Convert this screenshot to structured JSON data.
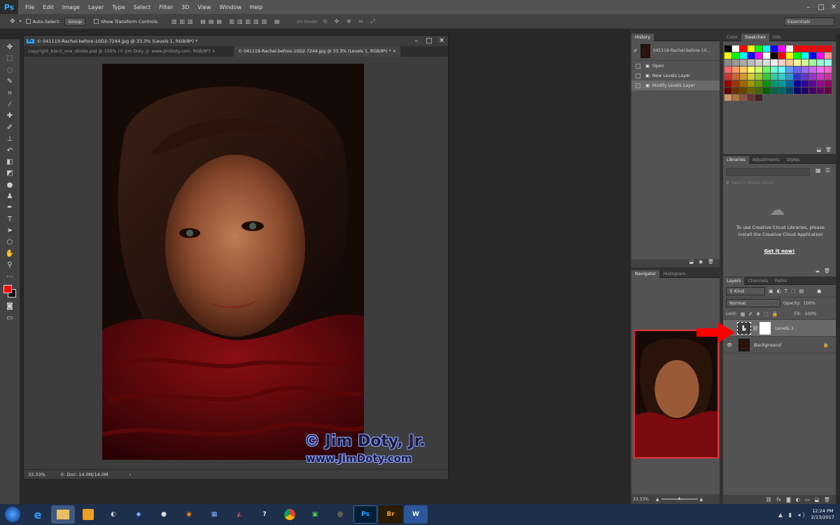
{
  "app": {
    "logo": "Ps"
  },
  "menu": [
    "File",
    "Edit",
    "Image",
    "Layer",
    "Type",
    "Select",
    "Filter",
    "3D",
    "View",
    "Window",
    "Help"
  ],
  "window_controls": [
    "–",
    "□",
    "✕"
  ],
  "options": {
    "auto_select_label": "Auto-Select:",
    "auto_select_value": "Group",
    "transform_label": "Show Transform Controls",
    "mode3d_label": "3D Mode:",
    "workspace": "Essentials"
  },
  "document": {
    "title": "© 041119-Rachel-before-10D2-7244.jpg @ 33.3% (Levels 1, RGB/8*) *",
    "tabs": [
      {
        "label": "copyright_black_one_stroke.psd @ 100% (© Jim Doty, Jr. www.JimDoty.com, RGB/8*) ×",
        "active": false
      },
      {
        "label": "© 041119-Rachel-before-10D2-7244.jpg @ 33.3% (Levels 1, RGB/8*) * ×",
        "active": true
      }
    ],
    "zoom": "33.33%",
    "doc_info": "Doc: 14.0M/14.0M",
    "watermark_line1": "© Jim Doty, Jr.",
    "watermark_line2": "www.JimDoty.com"
  },
  "history": {
    "tab": "History",
    "snapshot": "041119-Rachel-before-10...",
    "items": [
      "Open",
      "New Levels Layer",
      "Modify Levels Layer"
    ]
  },
  "navigator": {
    "tabs": [
      "Navigator",
      "Histogram"
    ],
    "zoom": "33.33%"
  },
  "swatches_panel": {
    "tabs": [
      "Color",
      "Swatches",
      "Info"
    ],
    "active": "Swatches"
  },
  "libraries": {
    "tabs": [
      "Libraries",
      "Adjustments",
      "Styles"
    ],
    "search_placeholder": "Search Adobe Stock",
    "message": "To use Creative Cloud Libraries, please install the Creative Cloud Application",
    "link": "Get it now!"
  },
  "layers": {
    "tabs": [
      "Layers",
      "Channels",
      "Paths"
    ],
    "filter": "Kind",
    "blend_mode": "Normal",
    "opacity_label": "Opacity:",
    "opacity": "100%",
    "lock_label": "Lock:",
    "fill_label": "Fill:",
    "fill": "100%",
    "items": [
      {
        "name": "Levels 1"
      },
      {
        "name": "Background"
      }
    ]
  },
  "taskbar": {
    "time": "12:24 PM",
    "date": "2/13/2017"
  },
  "colors": {
    "accent": "#31a8ff",
    "arrow": "#ff0000",
    "foreground": "#ff0000",
    "background": "#000000"
  }
}
